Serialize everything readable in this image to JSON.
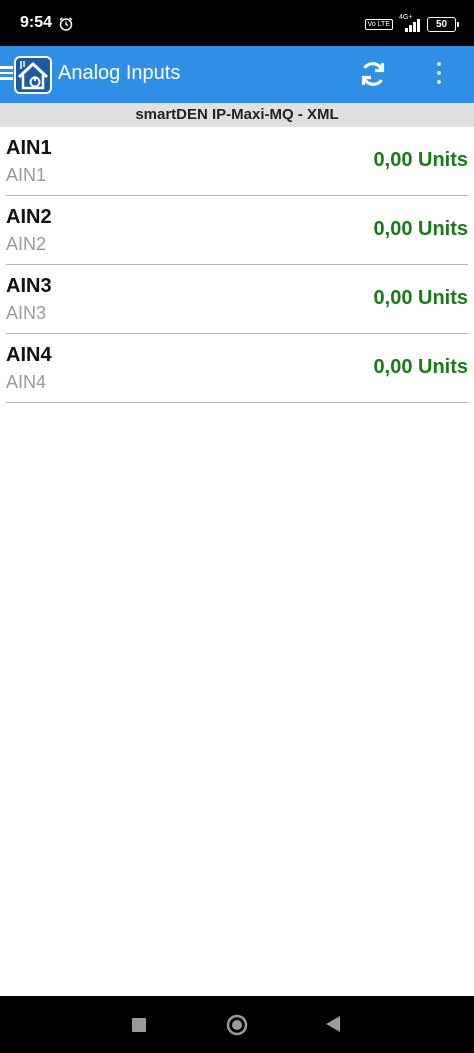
{
  "status_bar": {
    "time": "9:54",
    "volte_label": "Vo LTE",
    "network_label": "4G+",
    "battery": "50"
  },
  "app_bar": {
    "title": "Analog Inputs",
    "accent_color": "#2f8fe6",
    "icons": [
      "menu-icon",
      "app-logo-icon",
      "refresh-icon",
      "more-vert-icon"
    ]
  },
  "subheader": {
    "label": "smartDEN IP-Maxi-MQ - XML"
  },
  "inputs": [
    {
      "name": "AIN1",
      "label": "AIN1",
      "value": "0,00 Units"
    },
    {
      "name": "AIN2",
      "label": "AIN2",
      "value": "0,00 Units"
    },
    {
      "name": "AIN3",
      "label": "AIN3",
      "value": "0,00 Units"
    },
    {
      "name": "AIN4",
      "label": "AIN4",
      "value": "0,00 Units"
    }
  ],
  "value_color": "#1a7a1a",
  "nav_bar": {
    "icons": [
      "recents-icon",
      "home-icon",
      "back-icon"
    ]
  }
}
